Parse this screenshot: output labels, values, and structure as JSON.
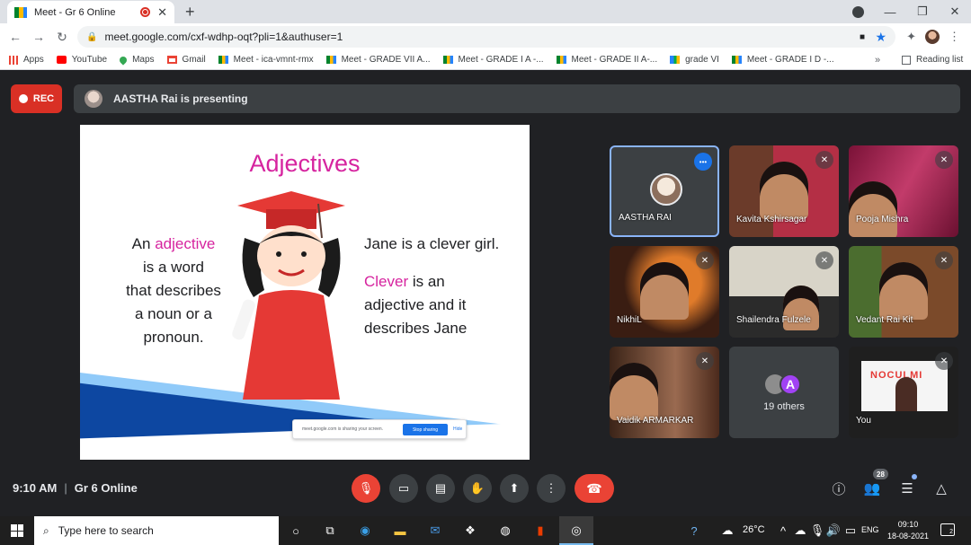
{
  "browser": {
    "tab_title": "Meet - Gr 6 Online",
    "new_tab": "+",
    "url": "meet.google.com/cxf-wdhp-oqt?pli=1&authuser=1",
    "bookmarks": [
      {
        "label": "Apps",
        "icon": "apps-icon"
      },
      {
        "label": "YouTube",
        "icon": "youtube-icon"
      },
      {
        "label": "Maps",
        "icon": "maps-icon"
      },
      {
        "label": "Gmail",
        "icon": "gmail-icon"
      },
      {
        "label": "Meet - ica-vmnt-rmx",
        "icon": "meet-icon"
      },
      {
        "label": "Meet - GRADE VII A...",
        "icon": "meet-icon"
      },
      {
        "label": "Meet - GRADE I A -...",
        "icon": "meet-icon"
      },
      {
        "label": "Meet - GRADE II A-...",
        "icon": "meet-icon"
      },
      {
        "label": "grade VI",
        "icon": "meet-icon"
      },
      {
        "label": "Meet - GRADE I D -...",
        "icon": "meet-icon"
      }
    ],
    "more_bookmarks": "»",
    "reading_list": "Reading list"
  },
  "meet": {
    "rec_label": "REC",
    "presenting_text": "AASTHA Rai is presenting",
    "time": "9:10 AM",
    "meeting_name": "Gr 6 Online",
    "participant_count": "28",
    "others_text": "19 others",
    "others_avatar_letter": "A"
  },
  "slide": {
    "title": "Adjectives",
    "left_pre": "An ",
    "left_hl": "adjective",
    "left_line2": "is  a word",
    "left_line3": "that describes",
    "left_line4": "a noun or a",
    "left_line5": "pronoun.",
    "right_line1": "Jane is a clever girl.",
    "right_hl": "Clever",
    "right_post": " is an",
    "right_line3": "adjective and it",
    "right_line4": "describes Jane",
    "share_text": "meet.google.com is sharing your screen.",
    "stop_label": "Stop sharing",
    "hide_label": "Hide"
  },
  "tiles": [
    {
      "name": "AASTHA RAI"
    },
    {
      "name": "Kavita Kshirsagar"
    },
    {
      "name": "Pooja Mishra"
    },
    {
      "name": "NikhiL"
    },
    {
      "name": "Shailendra Fulzele"
    },
    {
      "name": "Vedant Rai Kit"
    },
    {
      "name": "Vaidik ARMARKAR"
    },
    {
      "name": "You"
    }
  ],
  "you_card_text": "NOCULMI",
  "taskbar": {
    "search_placeholder": "Type here to search",
    "temperature": "26°C",
    "lang": "ENG",
    "clock_time": "09:10",
    "clock_date": "18-08-2021",
    "notif_count": "2"
  },
  "colors": {
    "meet_bg": "#202124",
    "accent_red": "#ea4335",
    "slide_pink": "#d6249f",
    "active_border": "#8ab4f8"
  }
}
